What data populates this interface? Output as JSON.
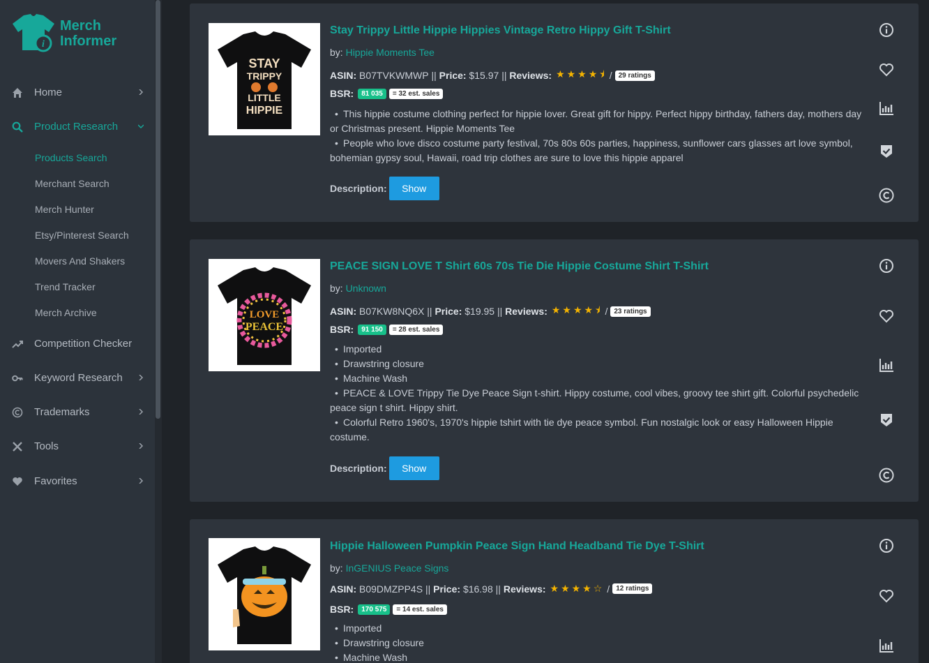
{
  "brand": {
    "line1": "Merch",
    "line2": "Informer",
    "accent": "#17a89a"
  },
  "sidebar": {
    "items": [
      {
        "label": "Home",
        "icon": "home-icon"
      },
      {
        "label": "Product Research",
        "icon": "search-icon",
        "expanded": true
      },
      {
        "label": "Competition Checker",
        "icon": "trend-icon"
      },
      {
        "label": "Keyword Research",
        "icon": "key-icon"
      },
      {
        "label": "Trademarks",
        "icon": "copyright-icon"
      },
      {
        "label": "Tools",
        "icon": "tools-icon"
      },
      {
        "label": "Favorites",
        "icon": "heart-icon"
      }
    ],
    "subitems": [
      {
        "label": "Products Search",
        "active": true
      },
      {
        "label": "Merchant Search"
      },
      {
        "label": "Merch Hunter"
      },
      {
        "label": "Etsy/Pinterest Search"
      },
      {
        "label": "Movers And Shakers"
      },
      {
        "label": "Trend Tracker"
      },
      {
        "label": "Merch Archive"
      }
    ]
  },
  "labels": {
    "by": "by:",
    "asin": "ASIN:",
    "price": "Price:",
    "reviews": "Reviews:",
    "bsr": "BSR:",
    "description": "Description:",
    "show": "Show",
    "sep": "||",
    "slash": "/"
  },
  "products": [
    {
      "title": "Stay Trippy Little Hippie Hippies Vintage Retro Hippy Gift T-Shirt",
      "brand": "Hippie Moments Tee",
      "asin": "B07TVKWMWP",
      "price": "$15.97",
      "rating": 4.5,
      "stars": "★★★★⯨",
      "ratings": "29 ratings",
      "bsr": "81 035",
      "sales": "= 32 est. sales",
      "design_text": "STAY TRIPPY LITTLE HIPPIE",
      "bullets": [
        "This hippie costume clothing perfect for hippie lover. Great gift for hippy. Perfect hippy birthday, fathers day, mothers day or Christmas present. Hippie Moments Tee",
        "People who love disco costume party festival, 70s 80s 60s parties, happiness, sunflower cars glasses art love symbol, bohemian gypsy soul, Hawaii, road trip clothes are sure to love this hippie apparel"
      ]
    },
    {
      "title": "PEACE SIGN LOVE T Shirt 60s 70s Tie Die Hippie Costume Shirt T-Shirt",
      "brand": "Unknown",
      "asin": "B07KW8NQ6X",
      "price": "$19.95",
      "rating": 4.5,
      "stars": "★★★★⯨",
      "ratings": "23 ratings",
      "bsr": "91 150",
      "sales": "= 28 est. sales",
      "design_text": "LOVE PEACE",
      "bullets": [
        "Imported",
        "Drawstring closure",
        "Machine Wash",
        "PEACE & LOVE Trippy Tie Dye Peace Sign t-shirt. Hippy costume, cool vibes, groovy tee shirt gift. Colorful psychedelic peace sign t shirt. Hippy shirt.",
        "Colorful Retro 1960's, 1970's hippie tshirt with tie dye peace symbol. Fun nostalgic look or easy Halloween Hippie costume."
      ]
    },
    {
      "title": "Hippie Halloween Pumpkin Peace Sign Hand Headband Tie Dye T-Shirt",
      "brand": "InGENIUS Peace Signs",
      "asin": "B09DMZPP4S",
      "price": "$16.98",
      "rating": 4,
      "stars": "★★★★☆",
      "ratings": "12 ratings",
      "bsr": "170 575",
      "sales": "= 14 est. sales",
      "bullets": [
        "Imported",
        "Drawstring closure",
        "Machine Wash"
      ]
    }
  ]
}
